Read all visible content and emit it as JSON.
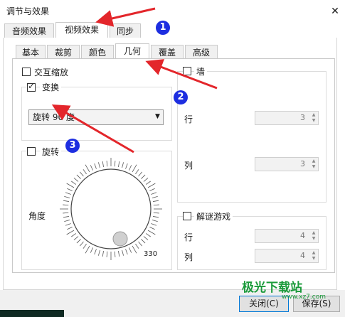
{
  "window": {
    "title": "调节与效果",
    "close_glyph": "✕"
  },
  "main_tabs": [
    {
      "label": "音频效果",
      "active": false
    },
    {
      "label": "视频效果",
      "active": true
    },
    {
      "label": "同步",
      "active": false
    }
  ],
  "sub_tabs": [
    {
      "label": "基本",
      "active": false
    },
    {
      "label": "裁剪",
      "active": false
    },
    {
      "label": "颜色",
      "active": false
    },
    {
      "label": "几何",
      "active": true
    },
    {
      "label": "覆盖",
      "active": false
    },
    {
      "label": "高级",
      "active": false
    }
  ],
  "geometry": {
    "interactive_zoom_label": "交互缩放",
    "interactive_zoom_checked": false,
    "transform_label": "变换",
    "transform_checked": true,
    "transform_select_value": "旋转 90 度",
    "rotate_label": "旋转",
    "rotate_checked": false,
    "angle_label": "角度",
    "dial_value_text": "330",
    "wall_label": "墙",
    "wall_checked": false,
    "wall_rows_label": "行",
    "wall_rows_value": "3",
    "wall_cols_label": "列",
    "wall_cols_value": "3",
    "puzzle_label": "解谜游戏",
    "puzzle_checked": false,
    "puzzle_rows_label": "行",
    "puzzle_rows_value": "4",
    "puzzle_cols_label": "列",
    "puzzle_cols_value": "4"
  },
  "footer": {
    "close_button": "关闭(C)",
    "save_button": "保存(S)"
  },
  "annotations": {
    "badge_1": "1",
    "badge_2": "2",
    "badge_3": "3",
    "arrow_color": "#e3262b",
    "badge_color": "#1d2ee0"
  },
  "watermark": {
    "text": "极光下载站",
    "sub": "www.xz7.com"
  },
  "colors": {
    "accent": "#0078d7",
    "watermark": "#1a9a3a"
  }
}
